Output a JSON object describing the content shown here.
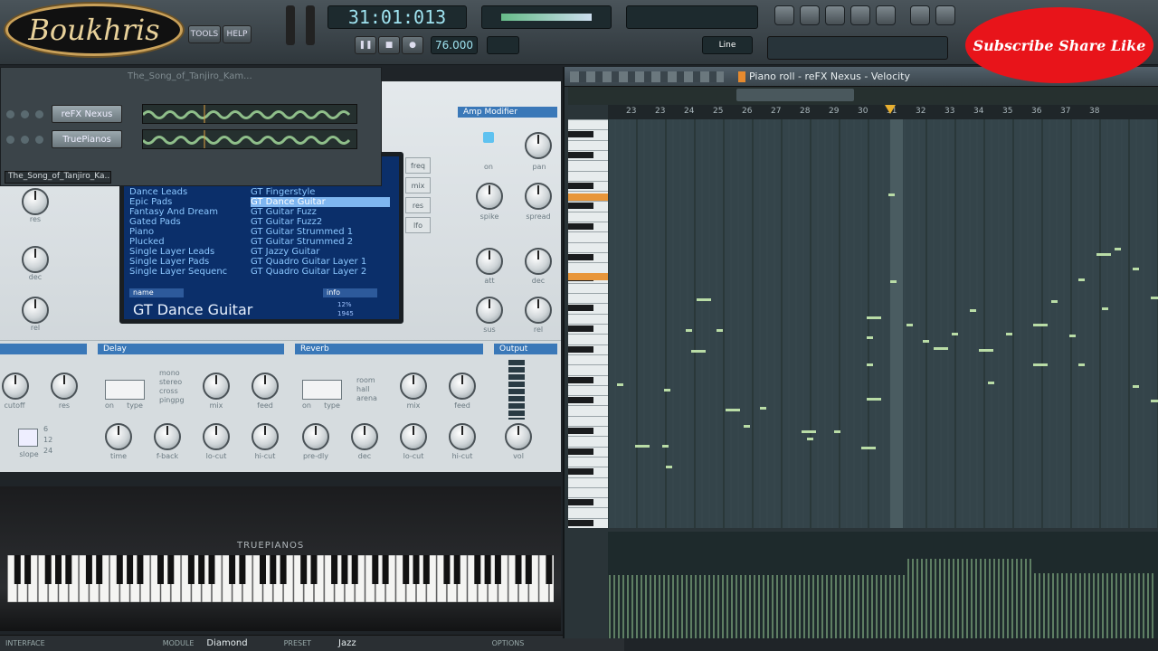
{
  "overlay": {
    "logo_text": "Boukhris",
    "subscribe_text": "Subscribe Share Like"
  },
  "topbar": {
    "menu": [
      "TOOLS",
      "HELP"
    ],
    "time_display": "31:01:013",
    "tempo": "76.000",
    "snap": "Line",
    "pattern_label": "The_Song_of_Tanjiro_Kam..."
  },
  "channel_rack": {
    "title": "The_Song_of_Tanjiro_Ka...",
    "channels": [
      {
        "name": "reFX Nexus"
      },
      {
        "name": "TruePianos"
      }
    ]
  },
  "plugin": {
    "amp_title": "Amp Modifier",
    "amp_knobs": [
      "on",
      "pan",
      "spike",
      "spread",
      "att",
      "dec",
      "sus",
      "rel"
    ],
    "left_knobs": [
      "res",
      "dec",
      "rel"
    ],
    "side_buttons": [
      "freq",
      "mix",
      "res",
      "lfo"
    ],
    "browser": {
      "categories": [
        "Dance Leads",
        "Epic Pads",
        "Fantasy And Dream",
        "Gated Pads",
        "Piano",
        "Plucked",
        "Single Layer Leads",
        "Single Layer Pads",
        "Single Layer Sequenc"
      ],
      "presets": [
        "GT Fingerstyle",
        "GT Dance Guitar",
        "GT Guitar Fuzz",
        "GT Guitar Fuzz2",
        "GT Guitar Strummed 1",
        "GT Guitar Strummed 2",
        "GT Jazzy Guitar",
        "GT Quadro Guitar Layer 1",
        "GT Quadro Guitar Layer 2"
      ],
      "selected_preset": "GT Dance Guitar",
      "tab_name": "name",
      "tab_info": "info",
      "current_preset": "GT Dance Guitar",
      "meter_a": "12%",
      "meter_b": "1945"
    },
    "delay": {
      "title": "Delay",
      "modes": [
        "mono",
        "stereo",
        "cross",
        "pingpg"
      ],
      "buttons": [
        "on",
        "type"
      ],
      "knobs": [
        "mix",
        "feed",
        "time",
        "f-back",
        "lo-cut",
        "hi-cut"
      ]
    },
    "reverb": {
      "title": "Reverb",
      "modes": [
        "room",
        "hall",
        "arena"
      ],
      "buttons": [
        "on",
        "type"
      ],
      "knobs": [
        "mix",
        "feed",
        "pre-dly",
        "dec",
        "lo-cut",
        "hi-cut"
      ]
    },
    "output": {
      "title": "Output",
      "knob": "vol"
    },
    "filter": {
      "knobs": [
        "cutoff",
        "res"
      ],
      "slope_label": "slope",
      "slope_values": [
        "6",
        "12",
        "24"
      ]
    }
  },
  "keyboard": {
    "brand": "TRUEPIANOS"
  },
  "bottombar": {
    "interface": "INTERFACE",
    "module": "MODULE",
    "module_value": "Diamond",
    "preset": "PRESET",
    "preset_value": "Jazz",
    "options": "OPTIONS"
  },
  "piano_roll": {
    "title": "Piano roll - reFX Nexus - Velocity",
    "ruler": [
      "23",
      "23",
      "24",
      "25",
      "26",
      "27",
      "28",
      "29",
      "30",
      "31",
      "32",
      "33",
      "34",
      "35",
      "36",
      "37",
      "38"
    ]
  }
}
